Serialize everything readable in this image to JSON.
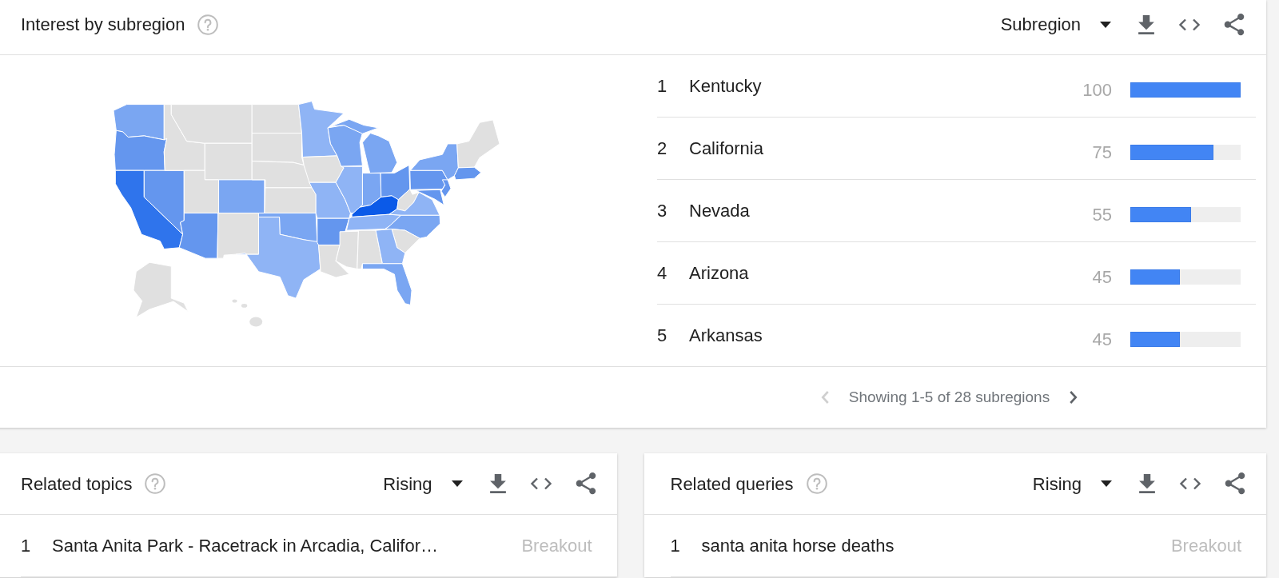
{
  "interest_by_subregion": {
    "title": "Interest by subregion",
    "dropdown": "Subregion",
    "rows": [
      {
        "rank": "1",
        "name": "Kentucky",
        "value": "100",
        "level": 1.0
      },
      {
        "rank": "2",
        "name": "California",
        "value": "75",
        "level": 0.75
      },
      {
        "rank": "3",
        "name": "Nevada",
        "value": "55",
        "level": 0.55
      },
      {
        "rank": "4",
        "name": "Arizona",
        "value": "45",
        "level": 0.45
      },
      {
        "rank": "5",
        "name": "Arkansas",
        "value": "45",
        "level": 0.45
      }
    ],
    "pagination": {
      "text": "Showing 1-5 of 28 subregions",
      "previous": {
        "disabled": true
      },
      "next": {
        "disabled": false
      }
    }
  },
  "related_panels": [
    {
      "title": "Related topics",
      "dropdown": "Rising",
      "rows": [
        {
          "rank": "1",
          "text": "Santa Anita Park - Racetrack in Arcadia, Califor…",
          "value": "Breakout"
        }
      ]
    },
    {
      "title": "Related queries",
      "dropdown": "Rising",
      "rows": [
        {
          "rank": "1",
          "text": "santa anita horse deaths",
          "value": "Breakout"
        }
      ]
    }
  ]
}
